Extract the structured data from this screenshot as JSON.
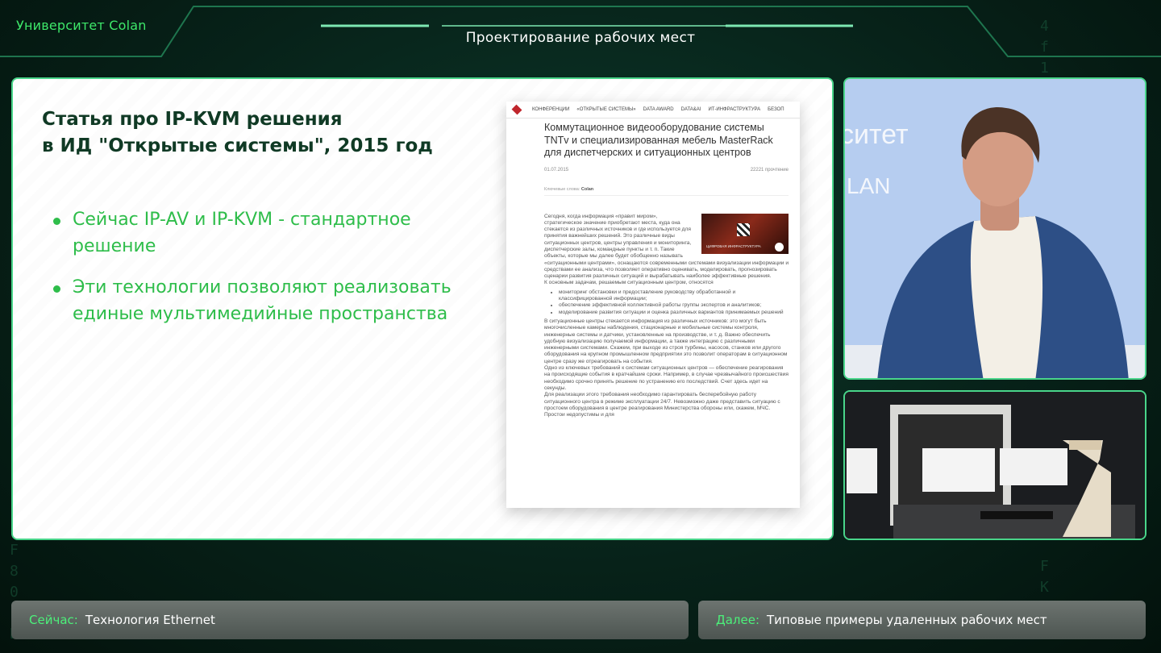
{
  "brand": "Университет Colan",
  "header": {
    "title": "Проектирование рабочих мест"
  },
  "slide": {
    "title": "Статья про IP-KVM решения\nв ИД \"Открытые системы\", 2015 год",
    "bullets": [
      "Сейчас IP-AV и IP-KVM - стандартное решение",
      "Эти технологии позволяют реализовать единые мультимедийные пространства"
    ],
    "article": {
      "nav": [
        "КОНФЕРЕНЦИИ",
        "«ОТКРЫТЫЕ СИСТЕМЫ»",
        "DATA AWARD",
        "DATA&AI",
        "ИТ-ИНФРАСТРУКТУРА",
        "БЕЗОП"
      ],
      "headline": "Коммутационное видеооборудование системы TNTv и специализированная мебель MasterRack для диспетчерских и ситуационных центров",
      "date": "01.07.2015",
      "views": "22221 прочтение",
      "tags_label": "Ключевые слова:",
      "tags_value": "Colan",
      "video_caption": "ЦИФРОВАЯ ИНФРАСТРУКТУРА",
      "para1": "Сегодня, когда информация «правит миром», стратегическое значение приобретают места, куда она стекается из различных источников и где используется для принятия важнейших решений. Это различные виды ситуационных центров, центры управления и мониторинга, диспетчерские залы, командные пункты и т. п. Такие объекты, которые мы далее будет обобщенно называть «ситуационными центрами», оснащаются современными системами визуализации информации и средствами ее анализа, что позволяет оперативно оценивать, моделировать, прогнозировать сценарии развития различных ситуаций и вырабатывать наиболее эффективные решения.",
      "para2": "К основным задачам, решаемым ситуационным центром, относятся",
      "list": [
        "мониторинг обстановки и предоставление руководству обработанной и классифицированной информации;",
        "обеспечение эффективной коллективной работы группы экспертов и аналитиков;",
        "моделирование развития ситуации и оценка различных вариантов принимаемых решений"
      ],
      "para3": "В ситуационные центры стекается информация из различных источников: это могут быть многочисленные камеры наблюдения, стационарные и мобильные системы контроля, инженерные системы и датчики, установленные на производстве, и т. д. Важно обеспечить удобную визуализацию получаемой информации, а также интеграцию с различными инженерными системами. Скажем, при выходе из строя турбины, насосов, станков или другого оборудования на крупном промышленном предприятии это позволит операторам в ситуационном центре сразу же отреагировать на события.",
      "para4": "Одно из ключевых требований к системам ситуационных центров — обеспечение реагирования на происходящие события в кратчайшие сроки. Например, в случае чрезвычайного происшествия необходимо срочно принять решение по устранению его последствий. Счет здесь идет на секунды.",
      "para5": "Для реализации этого требования необходимо гарантировать бесперебойную работу ситуационного центра в режиме эксплуатации 24/7. Невозможно даже представить ситуацию с простоем оборудования в центре реагирования Министерства обороны или, скажем, МЧС. Простои недопустимы и для"
    }
  },
  "camera_top": {
    "wall_text_1": "ситет",
    "wall_text_2": "LAN"
  },
  "now": {
    "label": "Сейчас:",
    "text": "Технология Ethernet"
  },
  "next": {
    "label": "Далее:",
    "text": "Типовые примеры удаленных рабочих мест"
  },
  "colors": {
    "accent": "#3ee86a",
    "frame": "#49d58a",
    "title_dark": "#103a25",
    "bullet_green": "#2ebd4a"
  }
}
